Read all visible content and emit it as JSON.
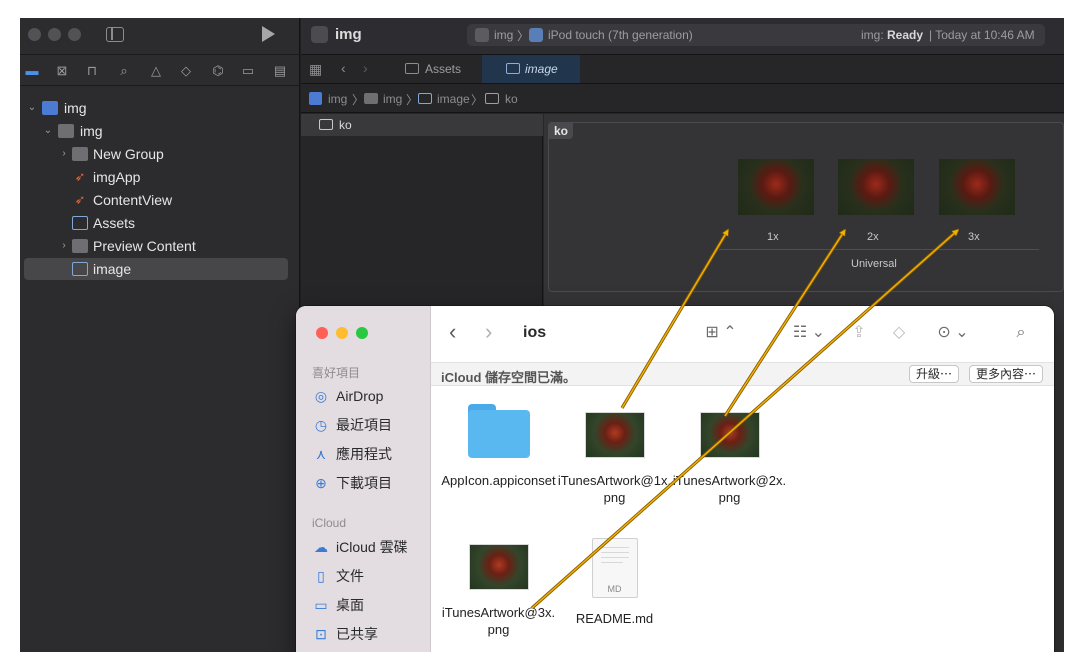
{
  "xcode": {
    "window_title": "img",
    "scheme": "img",
    "destination": "iPod touch (7th generation)",
    "status_prefix": "img:",
    "status_bold": "Ready",
    "status_time": "| Today at 10:46 AM",
    "tabs": [
      {
        "label": "Assets"
      },
      {
        "label": "image"
      }
    ],
    "jump_bar": [
      "img",
      "img",
      "image",
      "ko"
    ],
    "navigator_tree": [
      {
        "label": "img",
        "kind": "project",
        "disclosure": "expanded"
      },
      {
        "label": "img",
        "kind": "folder",
        "disclosure": "expanded"
      },
      {
        "label": "New Group",
        "kind": "folder",
        "disclosure": "collapsed"
      },
      {
        "label": "imgApp",
        "kind": "swift"
      },
      {
        "label": "ContentView",
        "kind": "swift"
      },
      {
        "label": "Assets",
        "kind": "asset-catalog"
      },
      {
        "label": "Preview Content",
        "kind": "folder",
        "disclosure": "collapsed"
      },
      {
        "label": "image",
        "kind": "asset-catalog",
        "selected": true
      }
    ],
    "asset_list": [
      {
        "label": "ko"
      }
    ],
    "image_set": {
      "name": "ko",
      "slots": [
        "1x",
        "2x",
        "3x"
      ],
      "group_label": "Universal"
    }
  },
  "finder": {
    "folder_name": "ios",
    "banner": "iCloud 儲存空間已滿。",
    "upgrade_button": "升級⋯",
    "more_button": "更多內容⋯",
    "sidebar": {
      "favorites_title": "喜好項目",
      "favorites": [
        {
          "label": "AirDrop",
          "icon": "airdrop-icon"
        },
        {
          "label": "最近項目",
          "icon": "clock-icon"
        },
        {
          "label": "應用程式",
          "icon": "applications-icon"
        },
        {
          "label": "下載項目",
          "icon": "download-icon"
        }
      ],
      "icloud_title": "iCloud",
      "icloud": [
        {
          "label": "iCloud 雲碟",
          "icon": "cloud-icon"
        },
        {
          "label": "文件",
          "icon": "document-icon"
        },
        {
          "label": "桌面",
          "icon": "desktop-icon"
        },
        {
          "label": "已共享",
          "icon": "shared-folder-icon"
        }
      ]
    },
    "files": [
      {
        "name": "AppIcon.appiconset",
        "kind": "folder"
      },
      {
        "name": "iTunesArtwork@1x.png",
        "kind": "png"
      },
      {
        "name": "iTunesArtwork@2x.png",
        "kind": "png"
      },
      {
        "name": "iTunesArtwork@3x.png",
        "kind": "png"
      },
      {
        "name": "README.md",
        "kind": "md",
        "badge": "MD"
      }
    ]
  },
  "annotation_colors": {
    "arrow_fill": "#f0b400",
    "arrow_stroke": "#8a5a00"
  }
}
